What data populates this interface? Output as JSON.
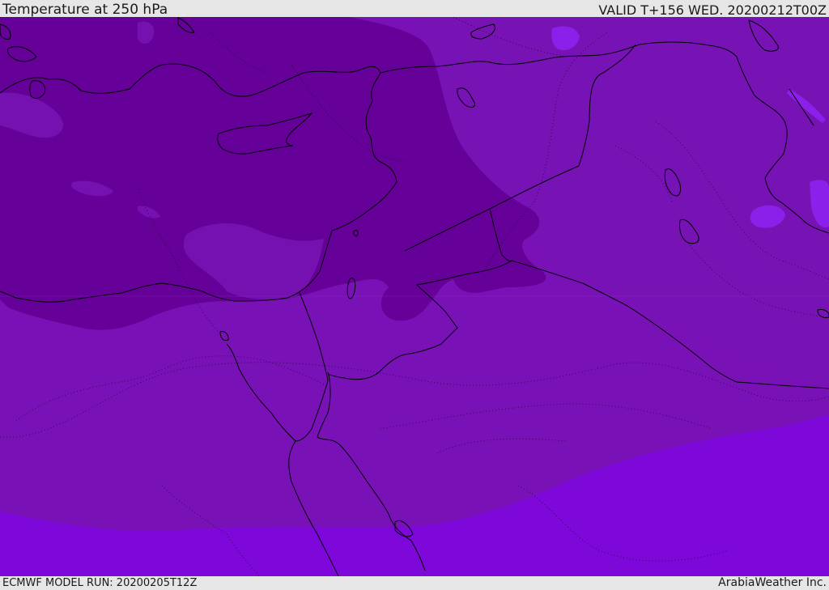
{
  "header": {
    "title": "Temperature at 250 hPa",
    "valid": "VALID T+156 WED. 20200212T00Z"
  },
  "footer": {
    "model_run": "ECMWF MODEL RUN: 20200205T12Z",
    "credit": "ArabiaWeather Inc."
  },
  "colors": {
    "coldest": "#660099",
    "cold": "#7411b0",
    "mid": "#7a10b8",
    "warm": "#7e0ad8",
    "warmest": "#8a20ea",
    "border": "#000000"
  }
}
